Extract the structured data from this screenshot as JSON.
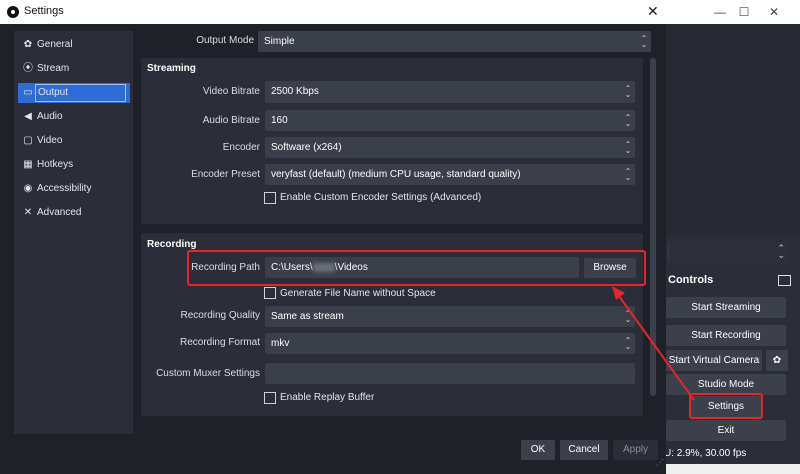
{
  "dialog": {
    "title": "Settings",
    "close_glyph": "✕"
  },
  "sidebar": {
    "items": [
      {
        "label": "General",
        "icon": "gear-icon",
        "glyph": "✿"
      },
      {
        "label": "Stream",
        "icon": "broadcast-icon",
        "glyph": "⦿"
      },
      {
        "label": "Output",
        "icon": "monitor-icon",
        "glyph": "▭"
      },
      {
        "label": "Audio",
        "icon": "speaker-icon",
        "glyph": "◀"
      },
      {
        "label": "Video",
        "icon": "video-icon",
        "glyph": "▢"
      },
      {
        "label": "Hotkeys",
        "icon": "keyboard-icon",
        "glyph": "▦"
      },
      {
        "label": "Accessibility",
        "icon": "accessibility-icon",
        "glyph": "◉"
      },
      {
        "label": "Advanced",
        "icon": "tools-icon",
        "glyph": "✕"
      }
    ],
    "active": "Output"
  },
  "output_mode": {
    "label": "Output Mode",
    "value": "Simple"
  },
  "streaming": {
    "title": "Streaming",
    "video_bitrate": {
      "label": "Video Bitrate",
      "value": "2500 Kbps"
    },
    "audio_bitrate": {
      "label": "Audio Bitrate",
      "value": "160"
    },
    "encoder": {
      "label": "Encoder",
      "value": "Software (x264)"
    },
    "encoder_preset": {
      "label": "Encoder Preset",
      "value": "veryfast (default) (medium CPU usage, standard quality)"
    },
    "custom_encoder": {
      "label": "Enable Custom Encoder Settings (Advanced)",
      "checked": false
    }
  },
  "recording": {
    "title": "Recording",
    "path": {
      "label": "Recording Path",
      "value_prefix": "C:\\Users\\",
      "value_suffix": "\\Videos"
    },
    "browse_label": "Browse",
    "gen_filename": {
      "label": "Generate File Name without Space",
      "checked": false
    },
    "quality": {
      "label": "Recording Quality",
      "value": "Same as stream"
    },
    "format": {
      "label": "Recording Format",
      "value": "mkv"
    },
    "muxer": {
      "label": "Custom Muxer Settings",
      "value": ""
    },
    "replay_buffer": {
      "label": "Enable Replay Buffer",
      "checked": false
    }
  },
  "footer": {
    "ok": "OK",
    "cancel": "Cancel",
    "apply": "Apply"
  },
  "main_window": {
    "controls_title": "Controls",
    "buttons": [
      "Start Streaming",
      "Start Recording",
      "Start Virtual Camera",
      "Studio Mode",
      "Settings",
      "Exit"
    ],
    "status": "U: 2.9%, 30.00 fps",
    "win_minimize": "—",
    "win_maximize": "☐",
    "win_close": "✕"
  },
  "colors": {
    "annotation": "#e8242b",
    "active_item": "#2e6bd4"
  }
}
